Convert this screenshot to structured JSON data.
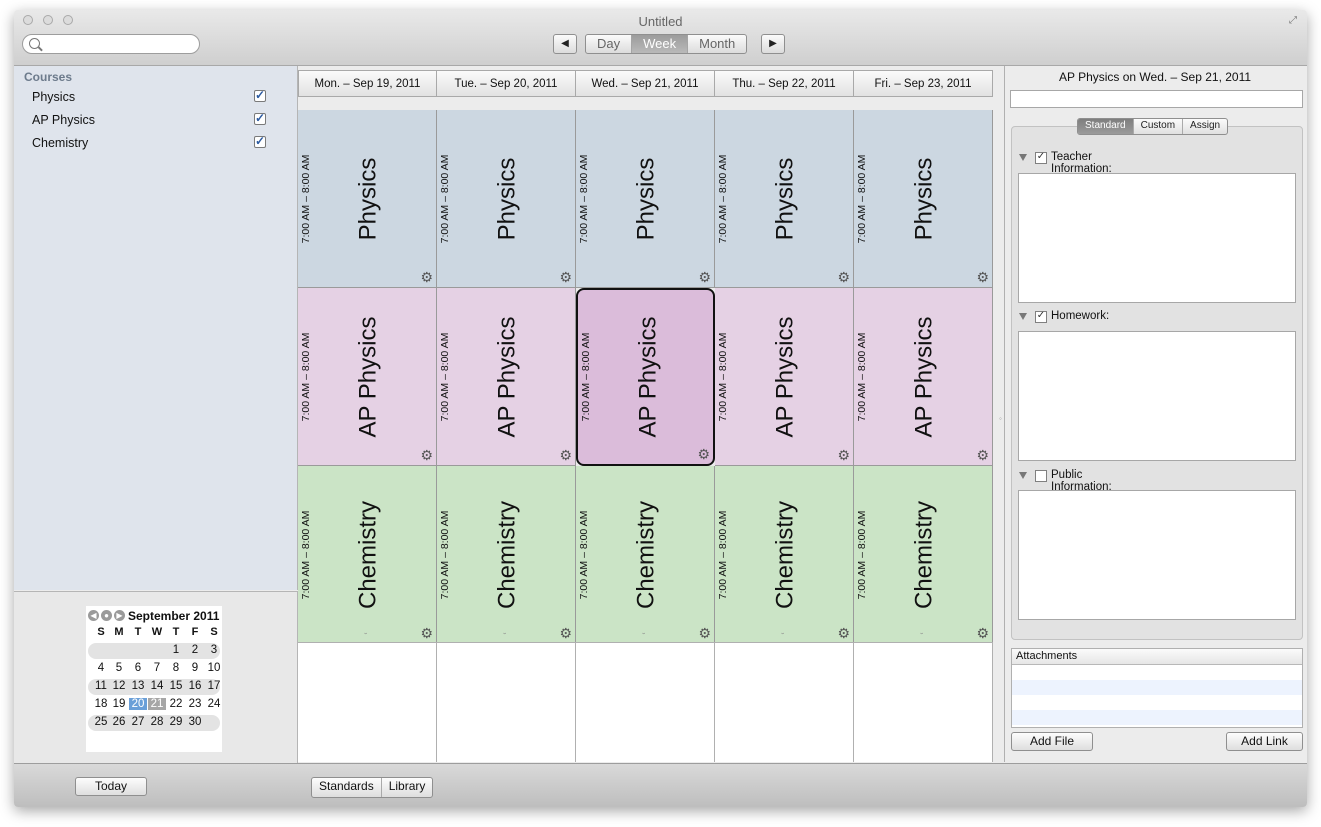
{
  "window": {
    "title": "Untitled"
  },
  "toolbar": {
    "search_value": "",
    "prev_label": "◀",
    "next_label": "▶",
    "views": [
      "Day",
      "Week",
      "Month"
    ],
    "active_view": "Week"
  },
  "sidebar": {
    "header": "Courses",
    "courses": [
      {
        "label": "Physics",
        "checked": "✓"
      },
      {
        "label": "AP Physics",
        "checked": "✓"
      },
      {
        "label": "Chemistry",
        "checked": "✓"
      }
    ]
  },
  "mini_calendar": {
    "title": "September 2011",
    "weekdays": [
      "S",
      "M",
      "T",
      "W",
      "T",
      "F",
      "S"
    ],
    "weeks": [
      [
        "",
        "",
        "",
        "",
        "1",
        "2",
        "3"
      ],
      [
        "4",
        "5",
        "6",
        "7",
        "8",
        "9",
        "10"
      ],
      [
        "11",
        "12",
        "13",
        "14",
        "15",
        "16",
        "17"
      ],
      [
        "18",
        "19",
        "20",
        "21",
        "22",
        "23",
        "24"
      ],
      [
        "25",
        "26",
        "27",
        "28",
        "29",
        "30",
        ""
      ]
    ],
    "selected_day": "20",
    "today": "21"
  },
  "week": {
    "days": [
      "Mon. – Sep 19, 2011",
      "Tue. – Sep 20, 2011",
      "Wed. – Sep 21, 2011",
      "Thu. – Sep 22, 2011",
      "Fri. – Sep 23, 2011"
    ],
    "blocks": [
      {
        "name": "Physics",
        "time": "7:00 AM – 8:00 AM",
        "color": "#ccd7e1"
      },
      {
        "name": "AP Physics",
        "time": "7:00 AM – 8:00 AM",
        "color": "#e5d1e4"
      },
      {
        "name": "Chemistry",
        "time": "7:00 AM – 8:00 AM",
        "color": "#cbe4c6"
      }
    ],
    "selected_block": {
      "day_index": 2,
      "block_index": 1,
      "color": "#dbbcda"
    },
    "gear_glyph": "⚙"
  },
  "inspector": {
    "title": "AP Physics on Wed. – Sep 21, 2011",
    "title_field_value": "",
    "tabs": [
      "Standard",
      "Custom",
      "Assign"
    ],
    "active_tab": "Standard",
    "sections": [
      {
        "label": "Teacher Information:",
        "checked": "✓"
      },
      {
        "label": "Homework:",
        "checked": "✓"
      },
      {
        "label": "Public Information:",
        "checked": ""
      }
    ],
    "attachments_header": "Attachments",
    "add_file_label": "Add File",
    "add_link_label": "Add Link"
  },
  "bottom": {
    "today_label": "Today",
    "tabs": [
      "Standards",
      "Library"
    ]
  }
}
